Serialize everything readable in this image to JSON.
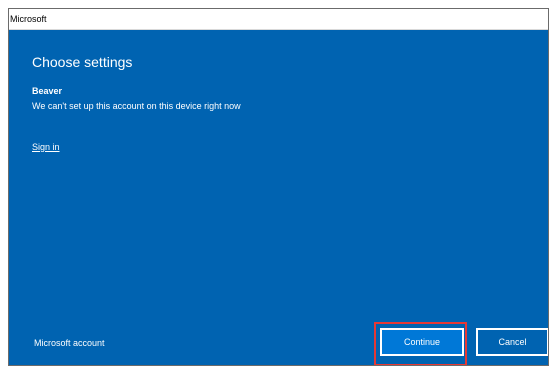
{
  "window": {
    "title": "Microsoft"
  },
  "dialog": {
    "heading": "Choose settings",
    "account_name": "Beaver",
    "message": "We can't set up this account on this device right now",
    "link_label": "Sign in",
    "footer_text": "Microsoft account",
    "continue_label": "Continue",
    "cancel_label": "Cancel"
  },
  "colors": {
    "dialog_bg": "#0063b1",
    "highlight": "#e53935"
  }
}
